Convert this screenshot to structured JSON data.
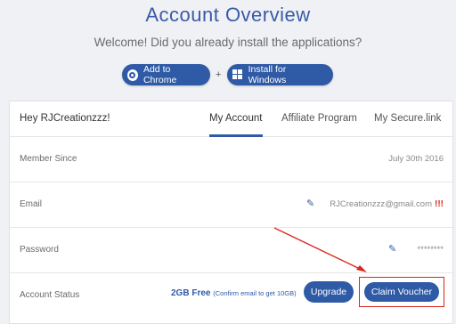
{
  "page": {
    "title": "Account Overview",
    "subtitle": "Welcome! Did you already install the applications?"
  },
  "install": {
    "chrome_label": "Add to Chrome",
    "plus": "+",
    "windows_label": "Install for Windows"
  },
  "card": {
    "greeting": "Hey RJCreationzzz!",
    "tabs": [
      {
        "label": "My Account",
        "active": true
      },
      {
        "label": "Affiliate Program",
        "active": false
      },
      {
        "label": "My Secure.link",
        "active": false
      }
    ],
    "rows": {
      "member_since": {
        "label": "Member Since",
        "value": "July 30th 2016"
      },
      "email": {
        "label": "Email",
        "value": "RJCreationzzz@gmail.com",
        "warning": "!!!"
      },
      "password": {
        "label": "Password",
        "value": "********"
      },
      "status": {
        "label": "Account Status",
        "plan": "2GB Free",
        "plan_note": "(Confirm email to get 10GB)",
        "upgrade_label": "Upgrade",
        "claim_label": "Claim Voucher"
      }
    }
  },
  "colors": {
    "accent": "#2e5aa6",
    "annotation": "#d9261c",
    "background": "#f0f1f4"
  },
  "icons": [
    "chrome-icon",
    "windows-icon",
    "pencil-icon"
  ]
}
